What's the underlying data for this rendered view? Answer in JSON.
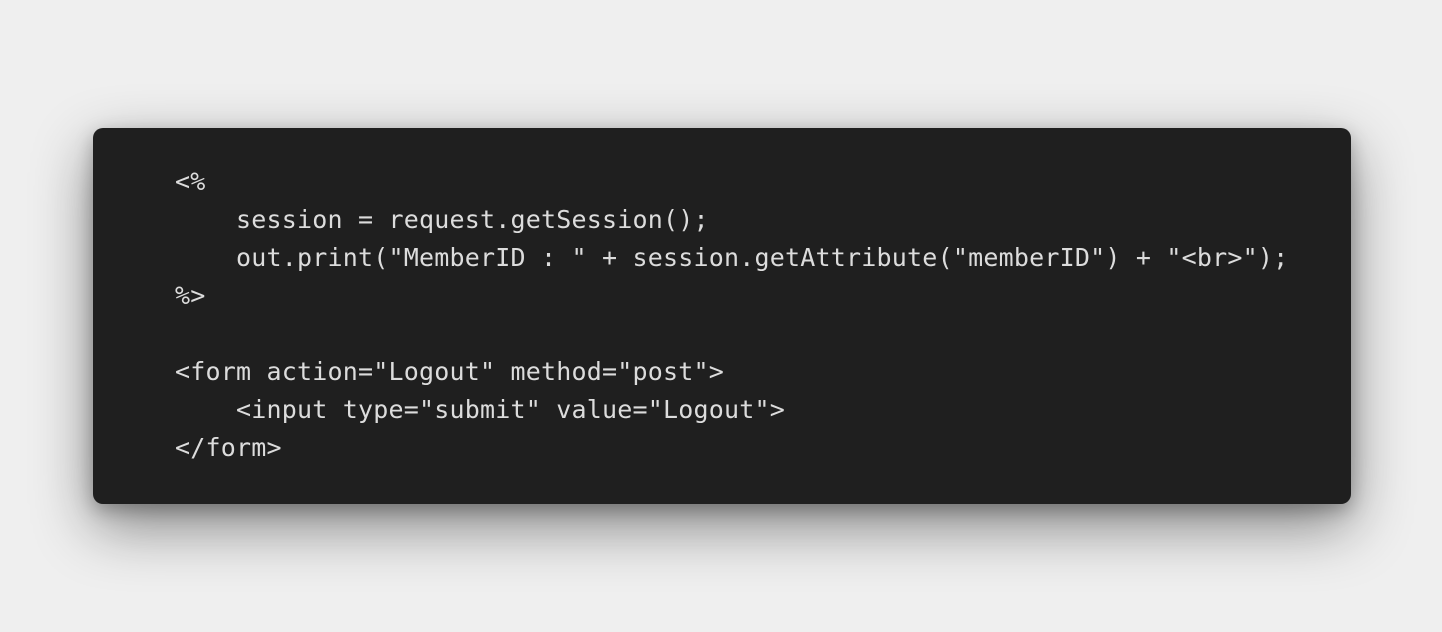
{
  "code": {
    "lines": [
      "<%",
      "    session = request.getSession();",
      "    out.print(\"MemberID : \" + session.getAttribute(\"memberID\") + \"<br>\");",
      "%>",
      "",
      "<form action=\"Logout\" method=\"post\">",
      "    <input type=\"submit\" value=\"Logout\">",
      "</form>"
    ]
  },
  "colors": {
    "background": "#efefef",
    "panel": "#1f1f1f",
    "text": "#dcdcdc"
  }
}
